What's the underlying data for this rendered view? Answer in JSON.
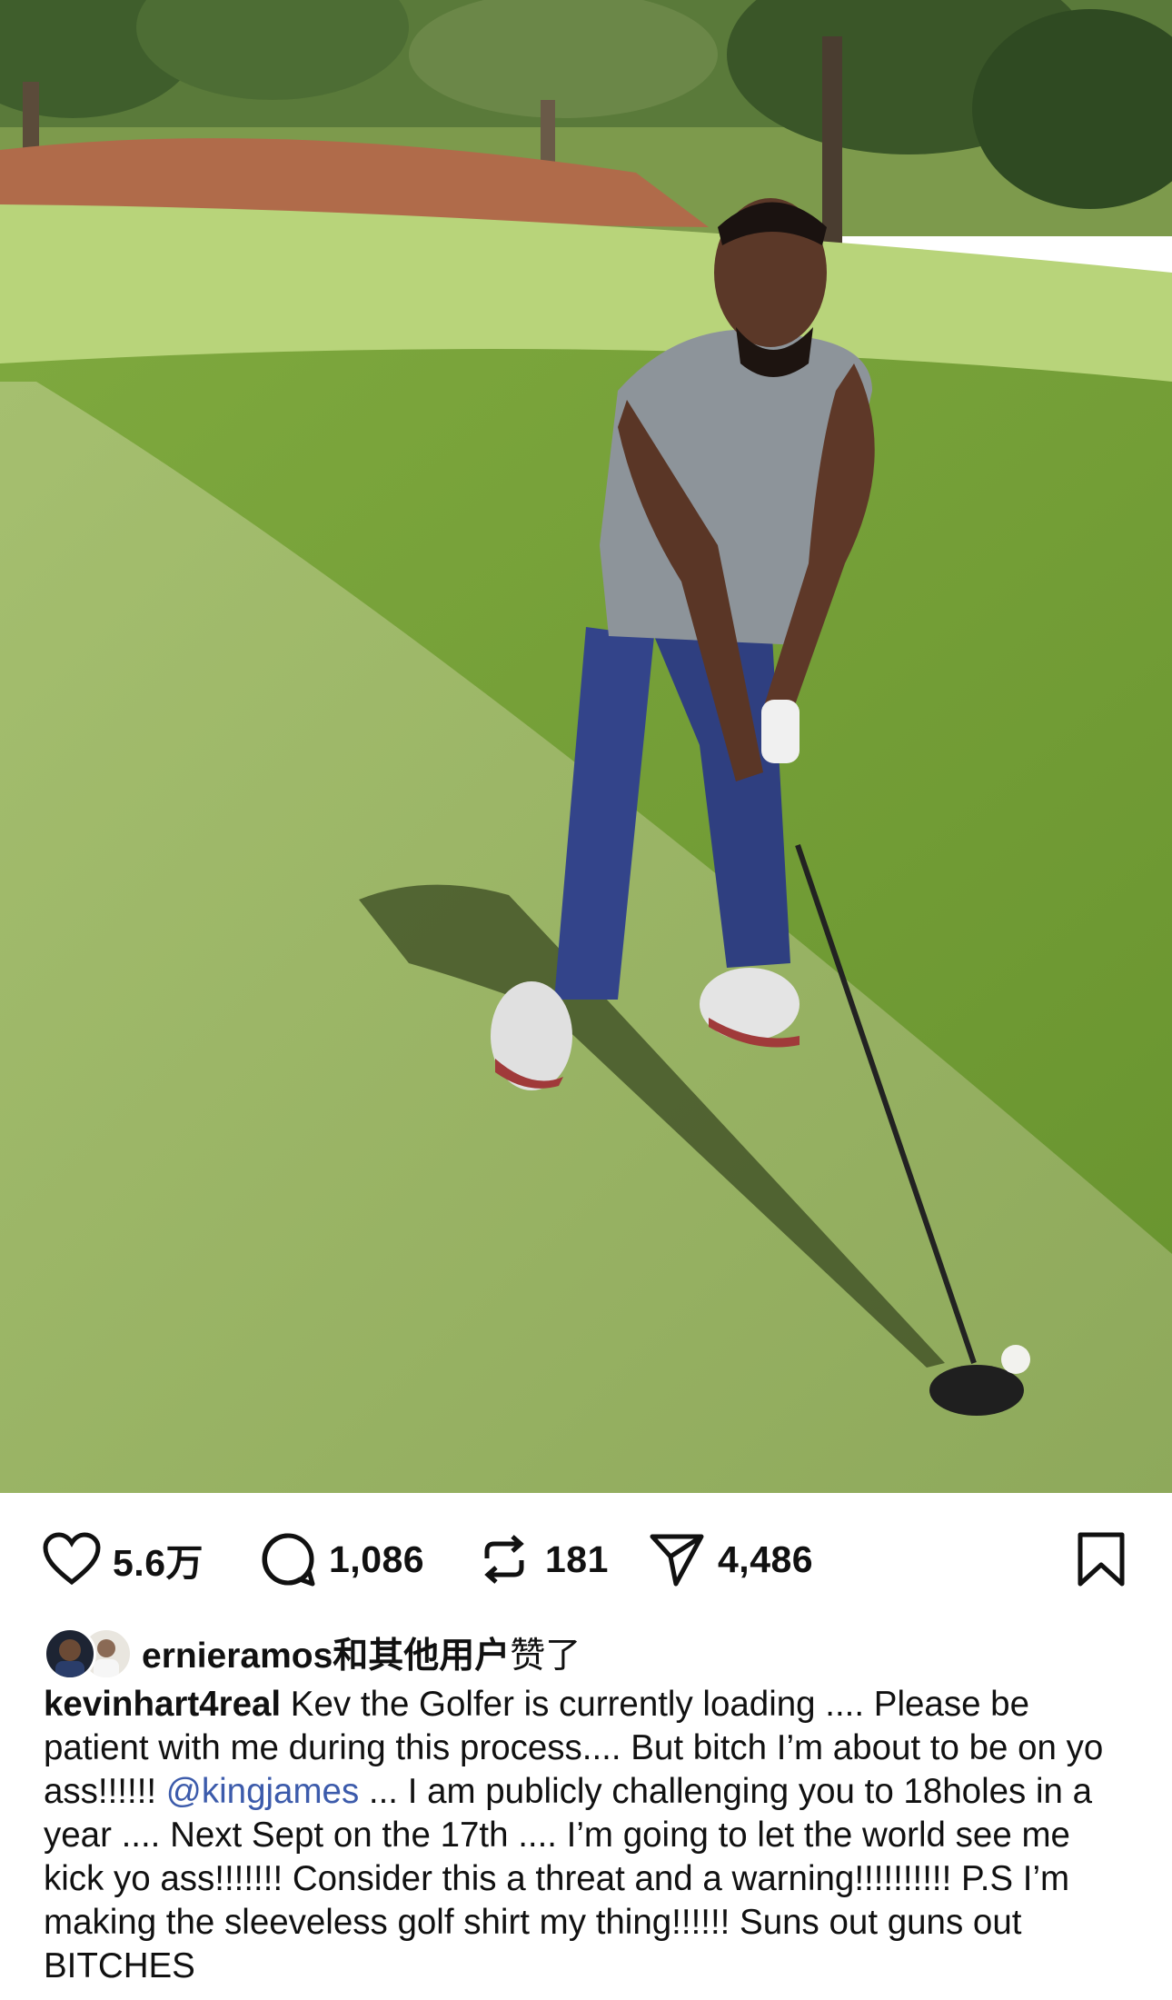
{
  "post": {
    "photo_icon": "golf-photo",
    "actions": {
      "like_icon": "heart-icon",
      "likes": "5.6万",
      "comment_icon": "comment-icon",
      "comments": "1,086",
      "repost_icon": "repost-icon",
      "reposts": "181",
      "share_icon": "send-icon",
      "shares": "4,486",
      "save_icon": "bookmark-icon"
    },
    "liked_by": {
      "user": "ernieramos",
      "suffix_bold": "和其他用户",
      "suffix": "赞了"
    },
    "caption": {
      "username": "kevinhart4real",
      "text_1": " Kev the Golfer is currently loading .... Please be patient with me during this process.... But bitch I’m about to be on yo ass!!!!!! ",
      "mention": "@kingjames",
      "text_2": " ... I am publicly challenging you to 18holes in a year .... Next Sept on the 17th .... I’m going to let the world see me kick yo ass!!!!!!! Consider this a threat and a warning!!!!!!!!!! P.S I’m making the sleeveless golf shirt my thing!!!!!! Suns out guns out BITCHES"
    }
  },
  "colors": {
    "mention": "#3c5bab",
    "text": "#111111",
    "background": "#ffffff"
  }
}
